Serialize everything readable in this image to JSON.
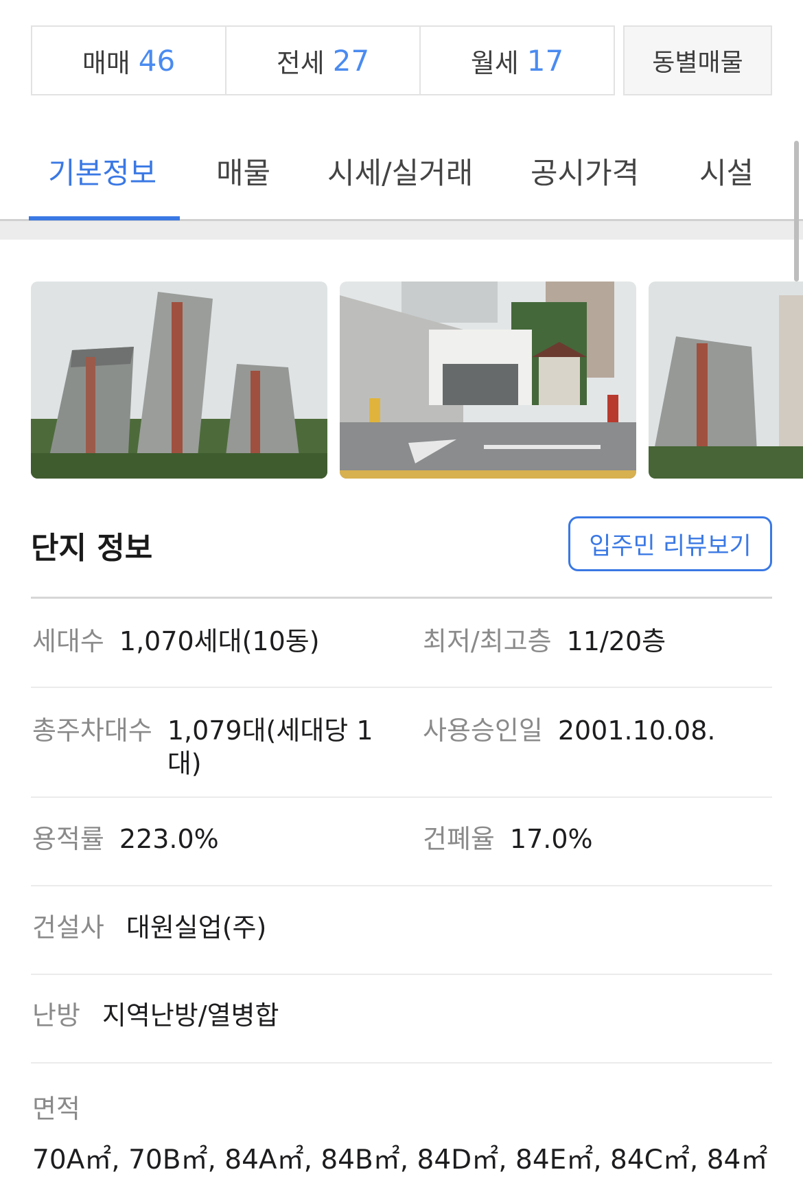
{
  "deal_tabs": [
    {
      "label": "매매",
      "count": "46"
    },
    {
      "label": "전세",
      "count": "27"
    },
    {
      "label": "월세",
      "count": "17"
    }
  ],
  "dong_button": "동별매물",
  "tabs": [
    "기본정보",
    "매물",
    "시세/실거래",
    "공시가격",
    "시설"
  ],
  "active_tab": "기본정보",
  "section": {
    "title": "단지 정보",
    "review_button": "입주민 리뷰보기"
  },
  "info": {
    "households": {
      "label": "세대수",
      "value": "1,070세대(10동)"
    },
    "floors": {
      "label": "최저/최고층",
      "value": "11/20층"
    },
    "parking": {
      "label": "총주차대수",
      "value": "1,079대(세대당 1대)"
    },
    "approval": {
      "label": "사용승인일",
      "value": "2001.10.08."
    },
    "far": {
      "label": "용적률",
      "value": "223.0%"
    },
    "bcr": {
      "label": "건폐율",
      "value": "17.0%"
    },
    "builder": {
      "label": "건설사",
      "value": "대원실업(주)"
    },
    "heating": {
      "label": "난방",
      "value": "지역난방/열병합"
    },
    "area": {
      "label": "면적",
      "value": "70A㎡, 70B㎡, 84A㎡, 84B㎡, 84D㎡, 84E㎡, 84C㎡, 84㎡"
    }
  },
  "colors": {
    "accent": "#3a78e4",
    "count": "#4a8bf0"
  }
}
